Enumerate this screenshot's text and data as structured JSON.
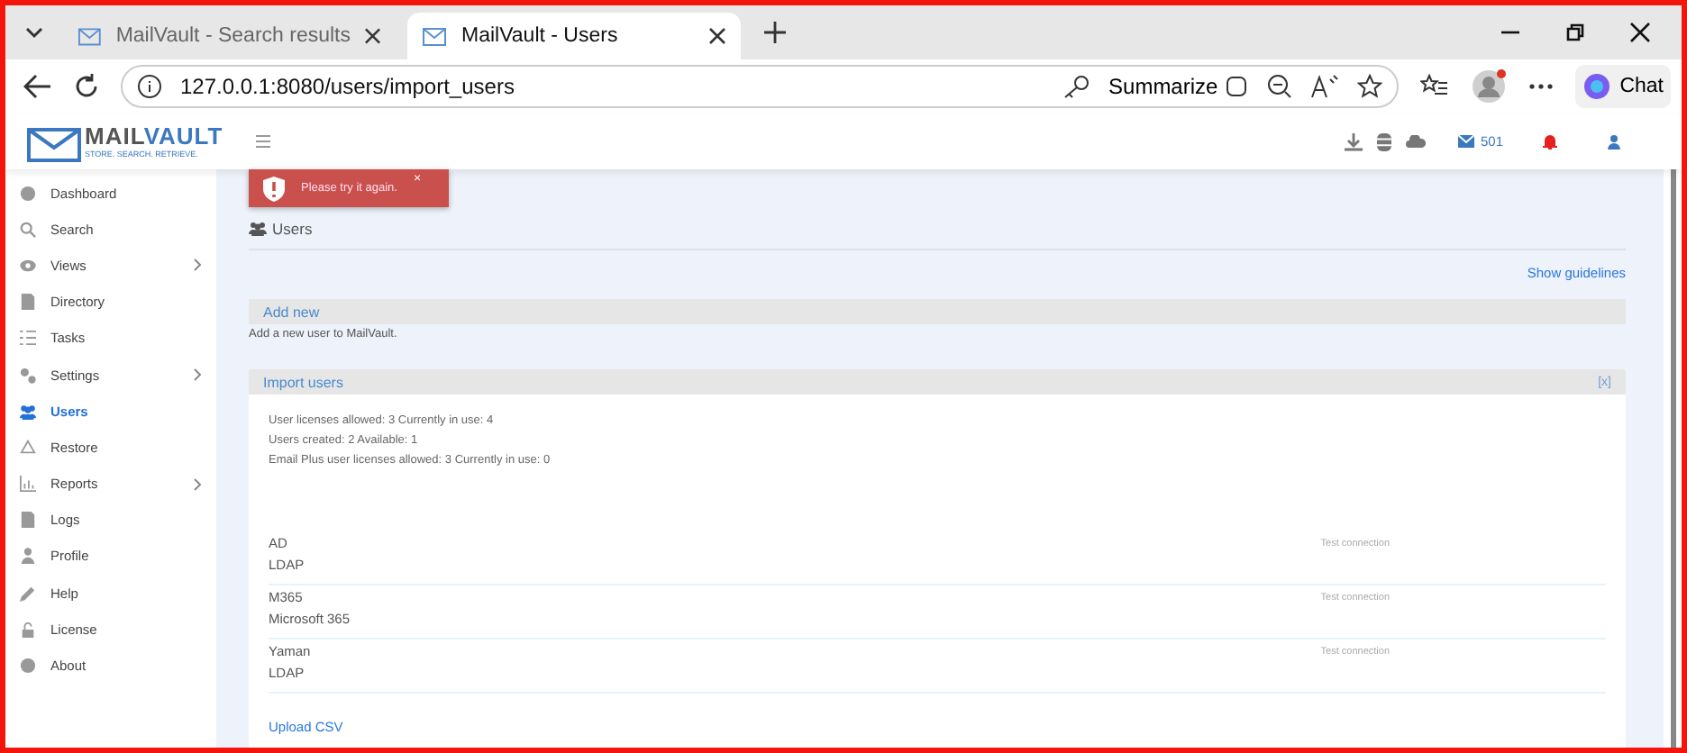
{
  "browser": {
    "tabs": [
      {
        "title": "MailVault - Search results",
        "selected": false
      },
      {
        "title": "MailVault - Users",
        "selected": true
      }
    ],
    "address": "127.0.0.1:8080/users/import_users",
    "summarize": "Summarize",
    "chat": "Chat"
  },
  "header": {
    "logo": {
      "primary": "MAIL",
      "secondary": "VAULT",
      "tagline": "STORE. SEARCH. RETRIEVE."
    },
    "mail_count": "501"
  },
  "sidebar": {
    "items": [
      {
        "label": "Dashboard",
        "selected": false,
        "expandable": false
      },
      {
        "label": "Search",
        "selected": false,
        "expandable": false
      },
      {
        "label": "Views",
        "selected": false,
        "expandable": true
      },
      {
        "label": "Directory",
        "selected": false,
        "expandable": false
      },
      {
        "label": "Tasks",
        "selected": false,
        "expandable": false
      },
      {
        "label": "Settings",
        "selected": false,
        "expandable": true
      },
      {
        "label": "Users",
        "selected": true,
        "expandable": false
      },
      {
        "label": "Restore",
        "selected": false,
        "expandable": false
      },
      {
        "label": "Reports",
        "selected": false,
        "expandable": true
      },
      {
        "label": "Logs",
        "selected": false,
        "expandable": false
      },
      {
        "label": "Profile",
        "selected": false,
        "expandable": false
      },
      {
        "label": "Help",
        "selected": false,
        "expandable": false
      },
      {
        "label": "License",
        "selected": false,
        "expandable": false
      },
      {
        "label": "About",
        "selected": false,
        "expandable": false
      }
    ]
  },
  "toast": {
    "message": "Please try it again.",
    "close": "×"
  },
  "page": {
    "title": "Users",
    "guidelines_link": "Show guidelines",
    "add_new": {
      "title": "Add new",
      "description": "Add a new user to MailVault."
    },
    "import_users": {
      "title": "Import users",
      "close": "[x]",
      "license_lines": [
        "User licenses allowed: 3   Currently in use: 4",
        "Users created: 2  Available: 1",
        "Email Plus user licenses allowed: 3  Currently in use: 0"
      ],
      "connections": [
        {
          "name": "AD",
          "type": "LDAP",
          "action": "Test connection"
        },
        {
          "name": "M365",
          "type": "Microsoft 365",
          "action": "Test connection"
        },
        {
          "name": "Yaman",
          "type": "LDAP",
          "action": "Test connection"
        }
      ],
      "upload_link": "Upload CSV"
    }
  }
}
